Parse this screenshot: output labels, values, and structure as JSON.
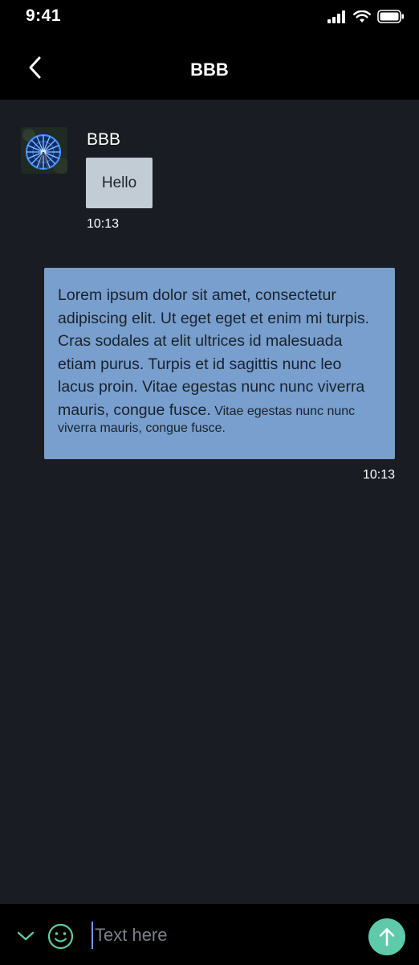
{
  "status_bar": {
    "time": "9:41"
  },
  "nav": {
    "title": "BBB"
  },
  "messages": {
    "incoming": {
      "sender": "BBB",
      "text": "Hello",
      "time": "10:13"
    },
    "outgoing": {
      "text": "Lorem ipsum dolor sit amet, consectetur adipiscing elit. Ut eget eget et enim mi turpis. Cras sodales at elit ultrices id malesuada etiam purus. Turpis et id sagittis nunc leo lacus proin. Vitae egestas nunc nunc viverra mauris, congue fusce.",
      "small_text": "Vitae egestas nunc nunc viverra mauris, congue fusce.",
      "time": "10:13"
    }
  },
  "input": {
    "placeholder": "Text here"
  },
  "colors": {
    "background": "#191c22",
    "bar": "#000000",
    "incoming_bubble": "#c2ccd5",
    "outgoing_bubble": "#789fcd",
    "accent": "#5fcaa9"
  },
  "icons": {
    "back": "chevron-left-icon",
    "chevron": "chevron-down-icon",
    "emoji": "smiley-icon",
    "send": "arrow-up-icon"
  }
}
